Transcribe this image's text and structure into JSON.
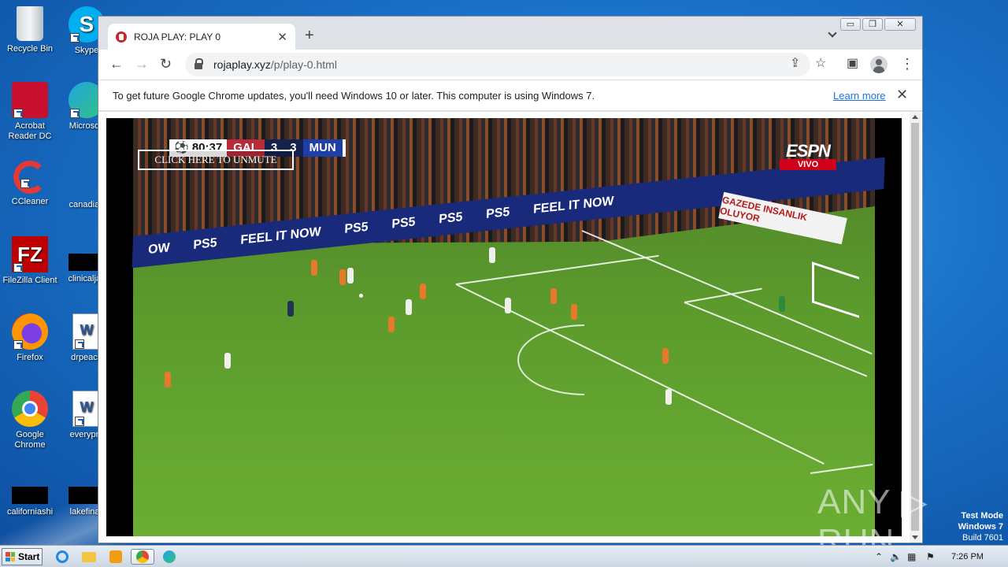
{
  "desktop": {
    "icons": [
      {
        "label": "Recycle Bin"
      },
      {
        "label": "Skype"
      },
      {
        "label": "Acrobat Reader DC"
      },
      {
        "label": "Microsoft"
      },
      {
        "label": "CCleaner"
      },
      {
        "label": "canadian"
      },
      {
        "label": "FileZilla Client"
      },
      {
        "label": "clinicaljac"
      },
      {
        "label": "Firefox"
      },
      {
        "label": "drpeace"
      },
      {
        "label": "Google Chrome"
      },
      {
        "label": "everypre"
      },
      {
        "label": "californiashi"
      },
      {
        "label": "lakefinall"
      }
    ],
    "watermark": {
      "line1": "Test Mode",
      "line2": "Windows 7",
      "line3": "Build 7601"
    }
  },
  "browser": {
    "tab": {
      "title": "ROJA PLAY: PLAY 0",
      "close": "✕"
    },
    "new_tab": "+",
    "url_host": "rojaplay.xyz",
    "url_path": "/p/play-0.html",
    "infobar": {
      "message": "To get future Google Chrome updates, you'll need Windows 10 or later. This computer is using Windows 7.",
      "link": "Learn more",
      "close": "✕"
    },
    "controls": {
      "minimize": "▭",
      "restore": "❐",
      "close": "✕"
    }
  },
  "video": {
    "score": {
      "time": "⚽ 80:37",
      "home": "GAL",
      "home_score": "3",
      "away_score": "3",
      "away": "MUN"
    },
    "unmute_label": "CLICK HERE TO UNMUTE",
    "broadcaster": "ESPN",
    "live_badge": "VIVO",
    "adboard_text": [
      "OW",
      "PS5",
      "FEEL IT NOW",
      "PS5",
      "PS5",
      "PS5",
      "PS5",
      "FEEL IT NOW"
    ],
    "banner": "GAZEDE INSANLIK OLUYOR"
  },
  "watermark_overlay": "ANY ▷ RUN",
  "taskbar": {
    "start_label": "Start",
    "clock": "7:26 PM"
  }
}
